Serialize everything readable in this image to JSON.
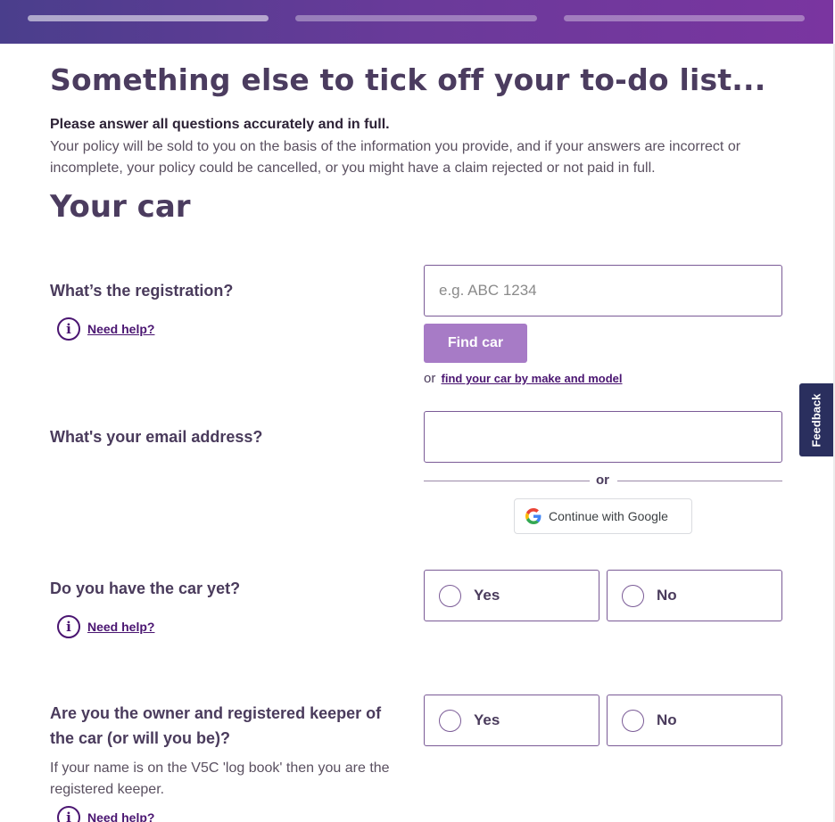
{
  "header": {
    "progress_steps": 3
  },
  "page": {
    "title": "Something else to tick off your to-do list...",
    "intro_strong": "Please answer all questions accurately and in full.",
    "intro_text": "Your policy will be sold to you on the basis of the information you provide, and if your answers are incorrect or incomplete, your policy could be cancelled, or you might have a claim rejected or not paid in full.",
    "section_title": "Your car"
  },
  "registration": {
    "label": "What’s the registration?",
    "placeholder": "e.g. ABC 1234",
    "value": "",
    "help_label": "Need help?",
    "find_button": "Find car",
    "alt_prefix": "or",
    "alt_link": "find your car by make and model"
  },
  "email": {
    "label": "What's your email address?",
    "value": "",
    "or_text": "or",
    "google_button": "Continue with Google"
  },
  "have_car": {
    "label": "Do you have the car yet?",
    "help_label": "Need help?",
    "options": [
      "Yes",
      "No"
    ]
  },
  "owner_keeper": {
    "label": "Are you the owner and registered keeper of the car (or will you be)?",
    "sub_text": "If your name is on the V5C 'log book' then you are the registered keeper.",
    "help_label": "Need help?",
    "options": [
      "Yes",
      "No"
    ]
  },
  "feedback": {
    "label": "Feedback"
  },
  "colors": {
    "accent": "#4a1571",
    "button": "#a77bc6",
    "header_start": "#4a3e8c",
    "header_end": "#7a35a0",
    "feedback_tab": "#2a2f5e"
  }
}
